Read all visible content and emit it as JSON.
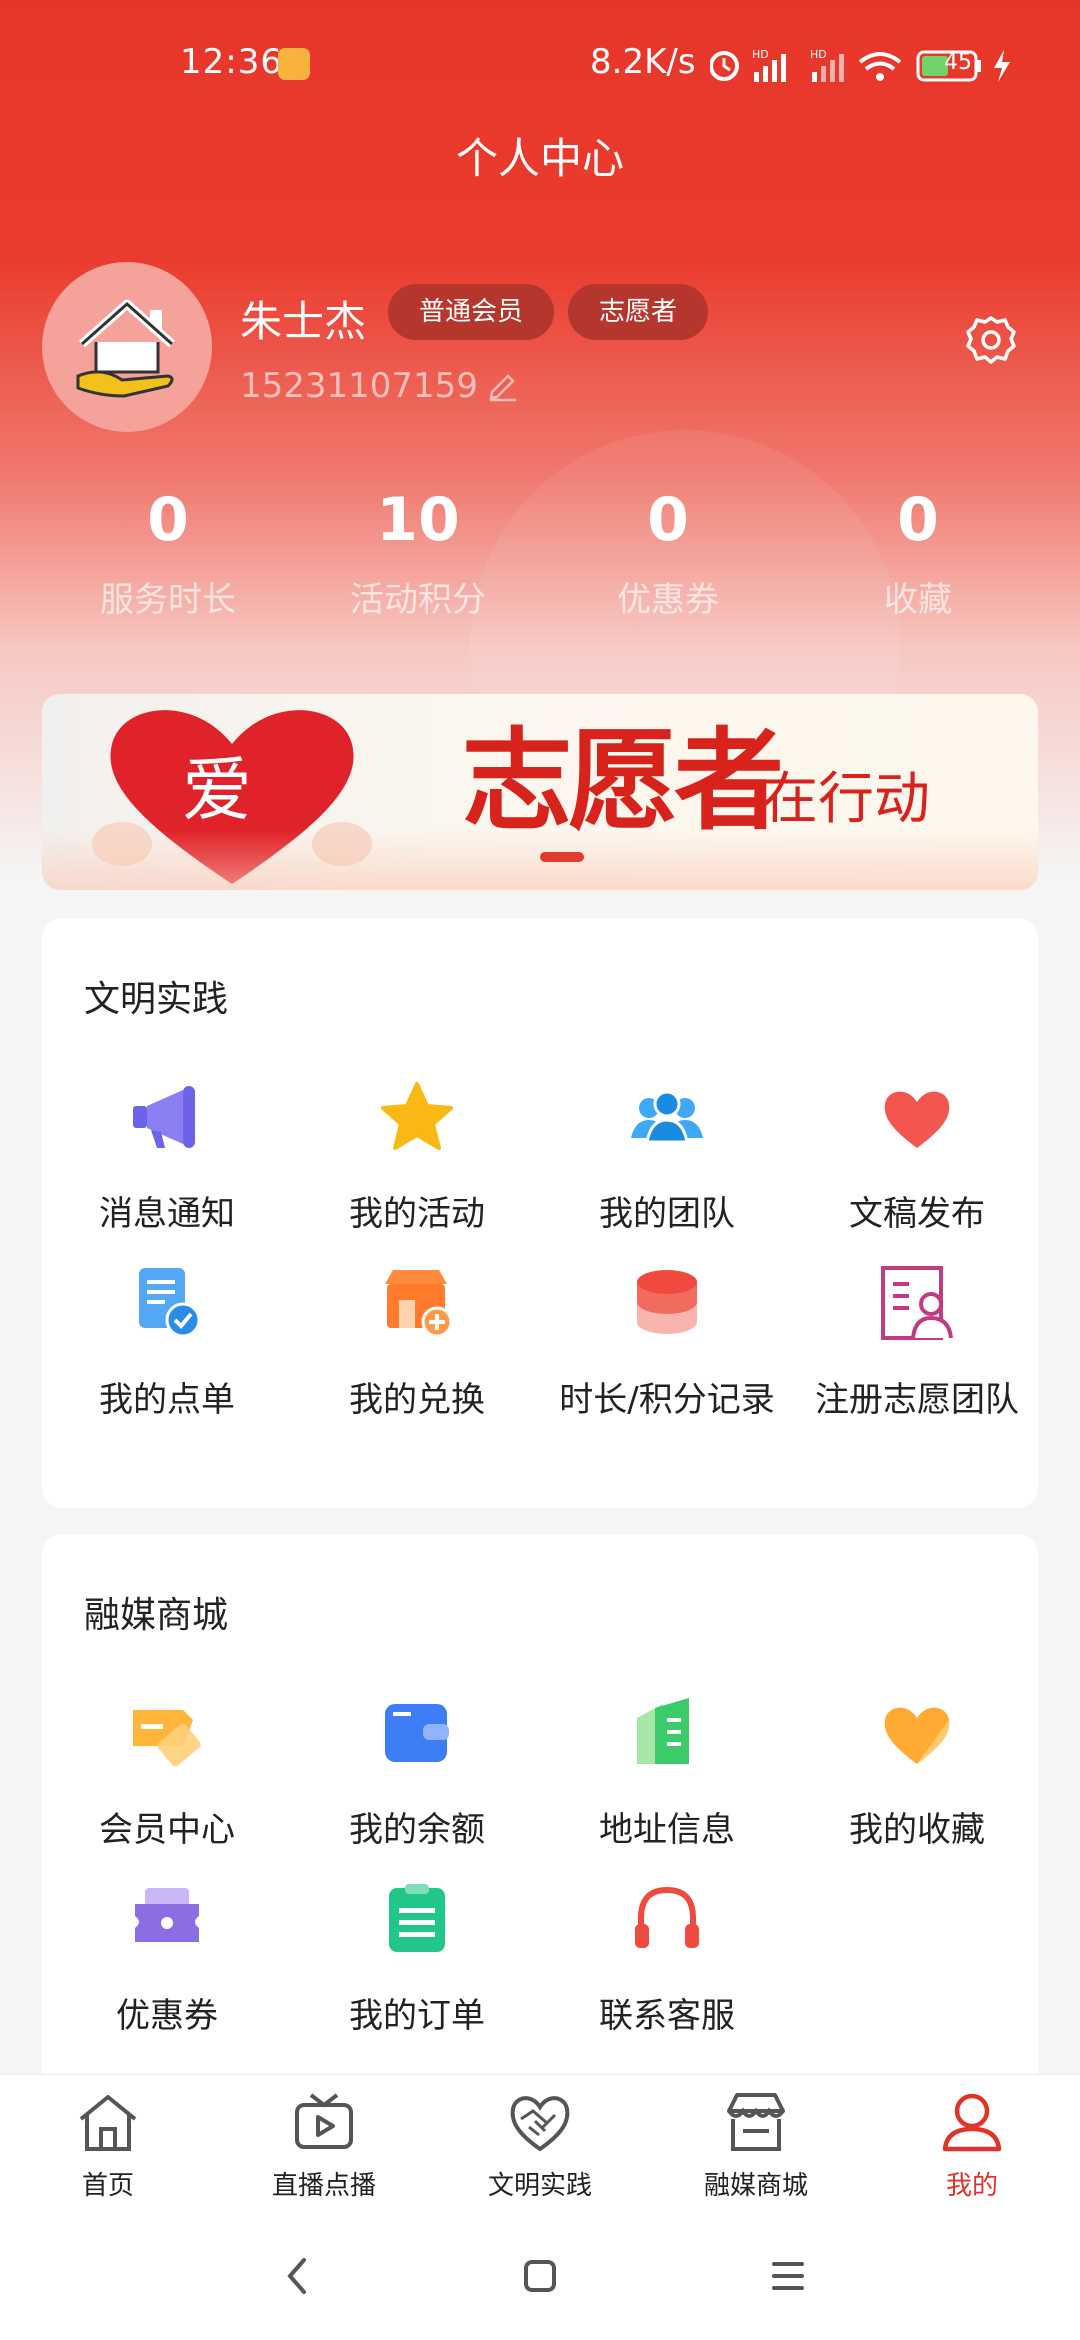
{
  "status_bar": {
    "time": "12:36",
    "speed": "8.2K/s",
    "battery": "45"
  },
  "header": {
    "title": "个人中心"
  },
  "profile": {
    "name": "朱士杰",
    "badges": [
      "普通会员",
      "志愿者"
    ],
    "phone": "15231107159"
  },
  "stats": [
    {
      "value": "0",
      "label": "服务时长"
    },
    {
      "value": "10",
      "label": "活动积分"
    },
    {
      "value": "0",
      "label": "优惠券"
    },
    {
      "value": "0",
      "label": "收藏"
    }
  ],
  "banner": {
    "slogan": "志愿者",
    "slogan_tail": "在行动",
    "heart_text": "爱"
  },
  "section1": {
    "title": "文明实践",
    "items": [
      {
        "label": "消息通知",
        "icon": "megaphone-icon"
      },
      {
        "label": "我的活动",
        "icon": "star-icon"
      },
      {
        "label": "我的团队",
        "icon": "team-icon"
      },
      {
        "label": "文稿发布",
        "icon": "heart-icon"
      },
      {
        "label": "我的点单",
        "icon": "order-doc-icon"
      },
      {
        "label": "我的兑换",
        "icon": "shop-exchange-icon"
      },
      {
        "label": "时长/积分记录",
        "icon": "coin-stack-icon"
      },
      {
        "label": "注册志愿团队",
        "icon": "register-team-icon"
      }
    ]
  },
  "section2": {
    "title": "融媒商城",
    "items": [
      {
        "label": "会员中心",
        "icon": "member-card-icon"
      },
      {
        "label": "我的余额",
        "icon": "wallet-icon"
      },
      {
        "label": "地址信息",
        "icon": "address-book-icon"
      },
      {
        "label": "我的收藏",
        "icon": "favorite-heart-icon"
      },
      {
        "label": "优惠券",
        "icon": "coupon-icon"
      },
      {
        "label": "我的订单",
        "icon": "order-list-icon"
      },
      {
        "label": "联系客服",
        "icon": "headset-icon"
      }
    ]
  },
  "tabbar": [
    {
      "label": "首页",
      "icon": "home-icon"
    },
    {
      "label": "直播点播",
      "icon": "tv-icon"
    },
    {
      "label": "文明实践",
      "icon": "handshake-heart-icon"
    },
    {
      "label": "融媒商城",
      "icon": "store-icon"
    },
    {
      "label": "我的",
      "icon": "user-icon",
      "active": true
    }
  ],
  "colors": {
    "primary": "#e8352a",
    "active_tab": "#e0342a"
  }
}
